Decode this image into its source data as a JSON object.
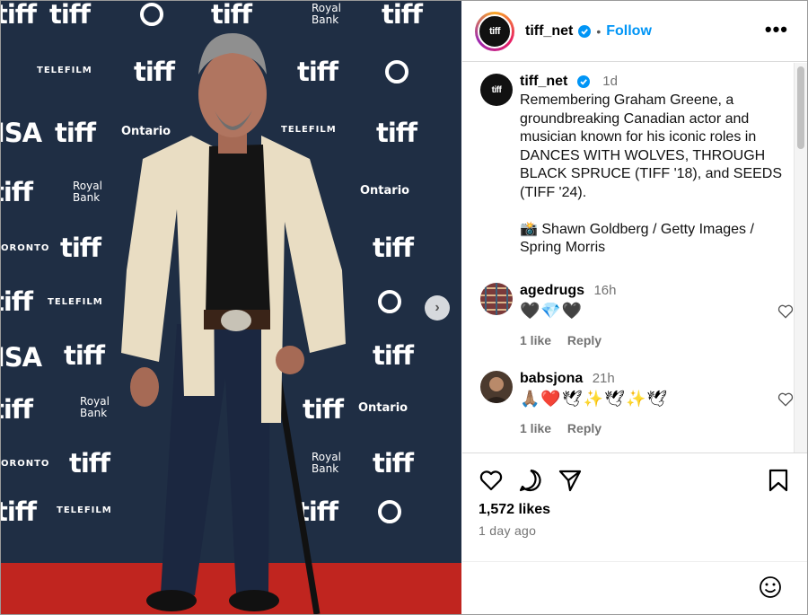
{
  "backdrop": {
    "brand": "tiff",
    "sponsor_telefilm": "TELEFILM",
    "sponsor_ontario": "Ontario",
    "sponsor_bank_line1": "Royal",
    "sponsor_bank_line2": "Bank",
    "sponsor_visa": "ISA",
    "sponsor_toronto": "ORONTO"
  },
  "header": {
    "avatar_text": "tiff",
    "username": "tiff_net",
    "separator": "•",
    "follow_label": "Follow",
    "more_label": "•••"
  },
  "caption": {
    "avatar_text": "tiff",
    "username": "tiff_net",
    "time": "1d",
    "text": "Remembering Graham Greene, a groundbreaking Canadian actor and musician known for his iconic roles in DANCES WITH WOLVES, THROUGH BLACK SPRUCE (TIFF '18), and SEEDS (TIFF '24).\n\n📸 Shawn Goldberg / Getty Images / Spring Morris"
  },
  "comments": [
    {
      "username": "agedrugs",
      "time": "16h",
      "text": "🖤💎🖤",
      "likes": "1 like",
      "reply_label": "Reply"
    },
    {
      "username": "babsjona",
      "time": "21h",
      "text": "🙏🏽❤️🕊✨🕊✨🕊",
      "likes": "1 like",
      "reply_label": "Reply"
    }
  ],
  "footer": {
    "likes": "1,572 likes",
    "time_ago": "1 day ago"
  },
  "colors": {
    "accent": "#0095f6",
    "verified": "#0095f6",
    "carpet": "#c0251f",
    "backdrop": "#1f2e44"
  }
}
